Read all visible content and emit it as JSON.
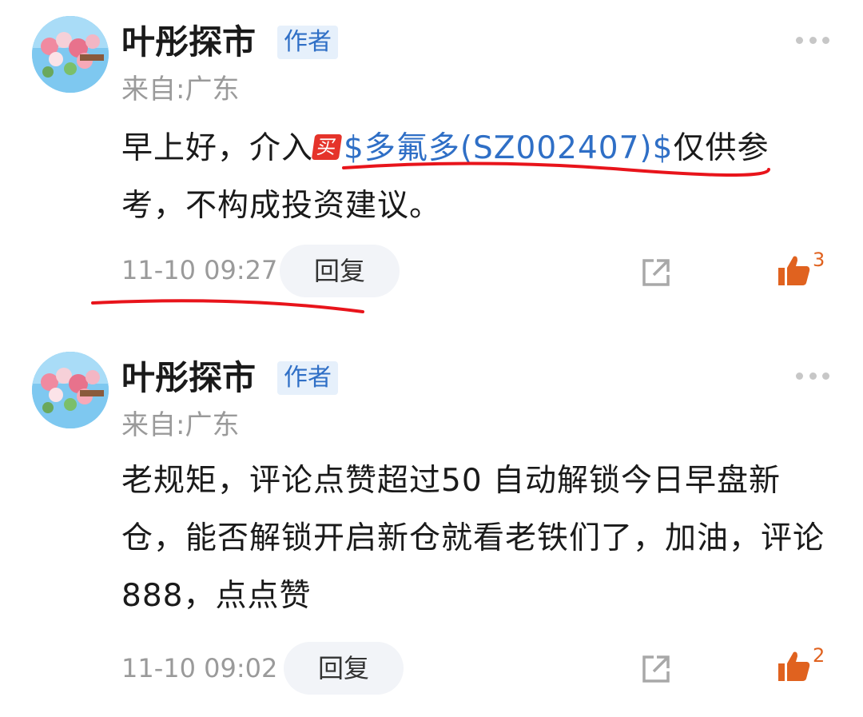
{
  "comments": [
    {
      "author": "叶彤探市",
      "badge": "作者",
      "location": "来自:广东",
      "text_before": "早上好，介入",
      "buy_badge": "买",
      "stock_link": "$多氟多(SZ002407)$",
      "text_after": "仅供参考，不构成投资建议。",
      "time": "11-10 09:27",
      "reply_label": "回复",
      "like_count": "3"
    },
    {
      "author": "叶彤探市",
      "badge": "作者",
      "location": "来自:广东",
      "text": "老规矩，评论点赞超过50 自动解锁今日早盘新仓，能否解锁开启新仓就看老铁们了，加油，评论888，点点赞",
      "time": "11-10 09:02",
      "reply_label": "回复",
      "like_count": "2"
    }
  ],
  "colors": {
    "accent": "#2f6fc6",
    "like": "#e0621f",
    "annotation": "#e8141b"
  },
  "icons": [
    "avatar-image",
    "more-icon",
    "share-icon",
    "thumbs-up-icon"
  ]
}
